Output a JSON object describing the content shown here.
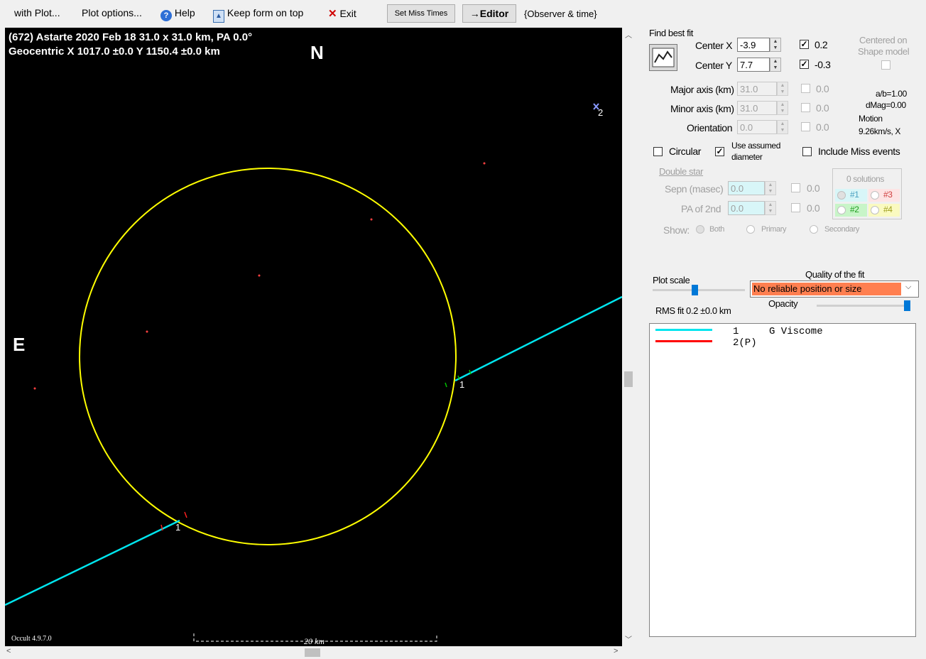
{
  "toolbar": {
    "with_plot": "with Plot...",
    "plot_options": "Plot options...",
    "help": "Help",
    "keep_on_top": "Keep form on top",
    "exit": "Exit",
    "set_miss_times": "Set Miss Times",
    "editor": "→Editor",
    "observer_time": "{Observer & time}"
  },
  "plot": {
    "header_line1": "(672) Astarte  2020 Feb 18  31.0 x 31.0 km, PA 0.0°",
    "header_line2": "Geocentric  X  1017.0 ±0.0  Y 1150.4 ±0.0 km",
    "north": "N",
    "east": "E",
    "chord1_label": "1",
    "chord1_label_b": "1",
    "miss_label": "2",
    "version": "Occult 4.9.7.0",
    "scale_label": "20 km",
    "colors": {
      "ellipse": "#ffff00",
      "chord1": "#00e5ee",
      "chord2": "#ff0000",
      "background": "#000000"
    }
  },
  "panel": {
    "find_best_fit": "Find best fit",
    "center_x_label": "Center X",
    "center_x": "-3.9",
    "center_x_check": "0.2",
    "center_y_label": "Center Y",
    "center_y": "7.7",
    "center_y_check": "-0.3",
    "centered_on": "Centered on",
    "shape_model": "Shape model",
    "major_label": "Major axis (km)",
    "major": "31.0",
    "major_check": "0.0",
    "minor_label": "Minor axis (km)",
    "minor": "31.0",
    "minor_check": "0.0",
    "orient_label": "Orientation",
    "orient": "0.0",
    "orient_check": "0.0",
    "ab_ratio": "a/b=1.00",
    "dmag": "dMag=0.00",
    "motion_label": "Motion",
    "motion": "9.26km/s, X",
    "circular": "Circular",
    "use_assumed": "Use assumed",
    "diameter": "diameter",
    "include_miss": "Include Miss events",
    "double_star": "Double star",
    "sepn_label": "Sepn (masec)",
    "sepn": "0.0",
    "sepn_check": "0.0",
    "pa2_label": "PA of 2nd",
    "pa2": "0.0",
    "pa2_check": "0.0",
    "solutions": "0 solutions",
    "sol1": "#1",
    "sol2": "#2",
    "sol3": "#3",
    "sol4": "#4",
    "show_label": "Show:",
    "show_both": "Both",
    "show_primary": "Primary",
    "show_secondary": "Secondary",
    "plot_scale": "Plot scale",
    "quality_label": "Quality of the fit",
    "quality_value": "No reliable position or size",
    "opacity": "Opacity",
    "rms_fit": "RMS fit 0.2 ±0.0 km",
    "legend": [
      {
        "num": "1",
        "observer": "G Viscome",
        "color": "#00e5ee"
      },
      {
        "num": "2(P)",
        "observer": "",
        "color": "#ff0000"
      }
    ]
  }
}
